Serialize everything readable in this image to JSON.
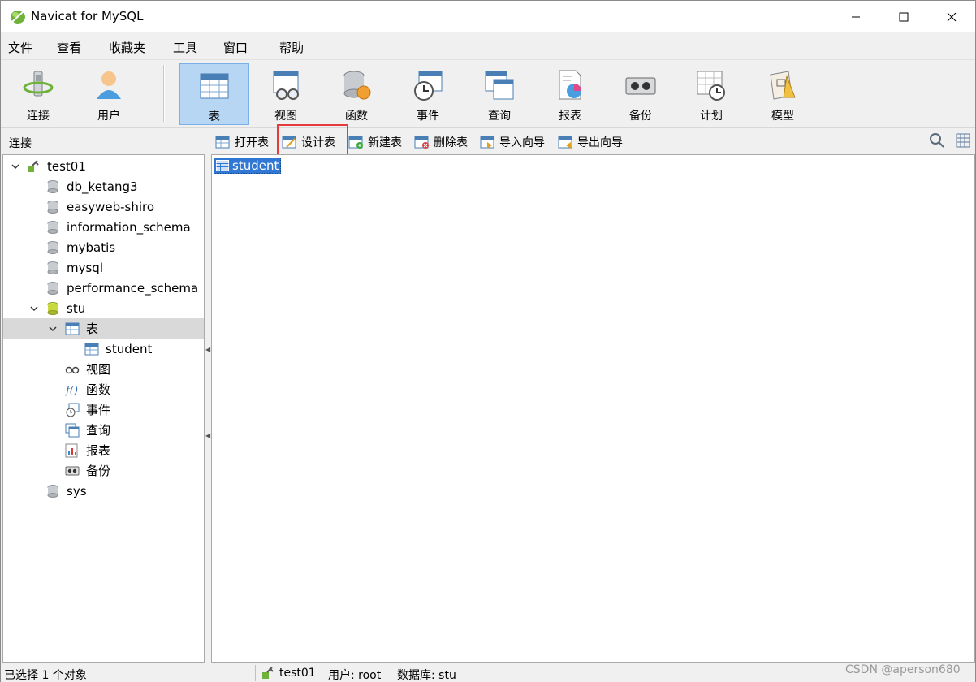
{
  "window": {
    "title": "Navicat for MySQL"
  },
  "menu": {
    "items": [
      "文件",
      "查看",
      "收藏夹",
      "工具",
      "窗口",
      "帮助"
    ]
  },
  "toolbar": {
    "buttons": [
      {
        "label": "连接",
        "icon": "connection-icon"
      },
      {
        "label": "用户",
        "icon": "user-icon"
      },
      {
        "label": "表",
        "icon": "table-icon",
        "active": true
      },
      {
        "label": "视图",
        "icon": "view-icon"
      },
      {
        "label": "函数",
        "icon": "function-icon"
      },
      {
        "label": "事件",
        "icon": "event-icon"
      },
      {
        "label": "查询",
        "icon": "query-icon"
      },
      {
        "label": "报表",
        "icon": "report-icon"
      },
      {
        "label": "备份",
        "icon": "backup-icon"
      },
      {
        "label": "计划",
        "icon": "schedule-icon"
      },
      {
        "label": "模型",
        "icon": "model-icon"
      }
    ]
  },
  "subbar": {
    "left_label": "连接",
    "actions": [
      {
        "label": "打开表",
        "icon": "open-table-icon"
      },
      {
        "label": "设计表",
        "icon": "design-table-icon"
      },
      {
        "label": "新建表",
        "icon": "new-table-icon"
      },
      {
        "label": "删除表",
        "icon": "delete-table-icon"
      },
      {
        "label": "导入向导",
        "icon": "import-wizard-icon"
      },
      {
        "label": "导出向导",
        "icon": "export-wizard-icon"
      }
    ]
  },
  "tree": {
    "connection": "test01",
    "databases": [
      "db_ketang3",
      "easyweb-shiro",
      "information_schema",
      "mybatis",
      "mysql",
      "performance_schema"
    ],
    "open_database": "stu",
    "tables_group": "表",
    "tables": [
      "student"
    ],
    "object_groups": [
      "视图",
      "函数",
      "事件",
      "查询",
      "报表",
      "备份"
    ],
    "last_database": "sys"
  },
  "objects": {
    "items": [
      "student"
    ]
  },
  "status": {
    "selection": "已选择 1 个对象",
    "connection": "test01",
    "user": "用户: root",
    "database": "数据库: stu",
    "watermark": "CSDN @aperson680"
  },
  "colors": {
    "active_tab_bg": "#b7d6f4",
    "selection_blue": "#3078d4",
    "highlight_red": "#e43b3b"
  }
}
